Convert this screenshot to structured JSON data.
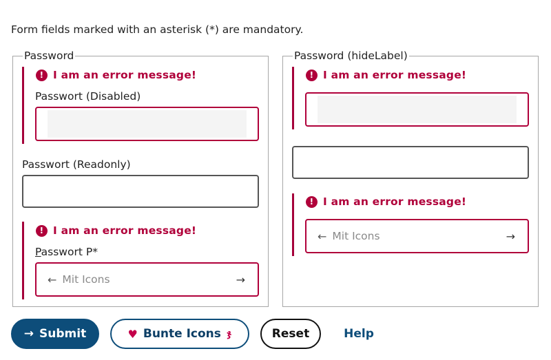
{
  "intro": "Form fields marked with an asterisk (*) are mandatory.",
  "left": {
    "legend": "Password",
    "error1": "I am an error message!",
    "disabled_label": "Passwort (Disabled)",
    "readonly_label": "Passwort (Readonly)",
    "error2": "I am an error message!",
    "p_label_first": "P",
    "p_label_rest": "asswort P",
    "p_required": "*",
    "icons_placeholder": "Mit Icons"
  },
  "right": {
    "legend": "Password (hideLabel)",
    "error1": "I am an error message!",
    "error2": "I am an error message!",
    "icons_placeholder": "Mit Icons"
  },
  "buttons": {
    "submit": "Submit",
    "bunte": "Bunte Icons",
    "reset": "Reset",
    "help": "Help"
  },
  "icons": {
    "error": "!",
    "arrow_left": "←",
    "arrow_right": "→",
    "heart": "♥",
    "squirrel": "ჯ"
  },
  "colors": {
    "error": "#b0003a",
    "primary": "#0d4d7a"
  }
}
